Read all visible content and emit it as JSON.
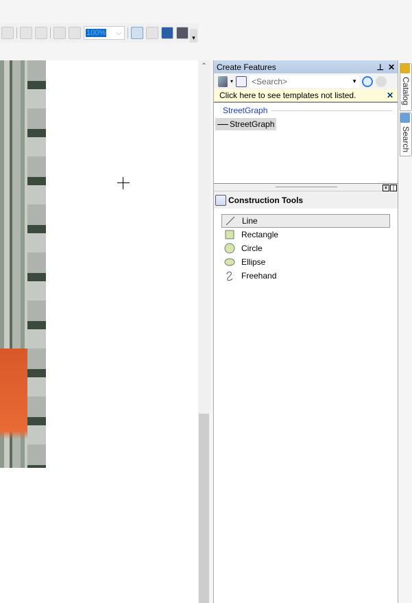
{
  "toolbar": {
    "zoom_value": "100%",
    "icons": [
      "fixed-zoom-icon",
      "zoom-in-fixed-icon",
      "zoom-out-fixed-icon",
      "back-icon",
      "forward-icon",
      "toggle-draft-mode-icon",
      "focus-data-frame-icon",
      "change-layout-icon",
      "data-driven-pages-icon"
    ]
  },
  "create_features": {
    "title": "Create Features",
    "search_placeholder": "<Search>",
    "notice": "Click here to see templates not listed.",
    "group": "StreetGraph",
    "template": "StreetGraph"
  },
  "construction_tools": {
    "title": "Construction Tools",
    "tools": [
      {
        "label": "Line",
        "icon": "line-icon",
        "selected": true
      },
      {
        "label": "Rectangle",
        "icon": "rectangle-icon"
      },
      {
        "label": "Circle",
        "icon": "circle-icon"
      },
      {
        "label": "Ellipse",
        "icon": "ellipse-icon"
      },
      {
        "label": "Freehand",
        "icon": "freehand-icon"
      }
    ]
  },
  "side_tabs": [
    "Catalog",
    "Search"
  ],
  "colors": {
    "accent": "#0a6ccf",
    "title_bar": "#b7cbe4",
    "notice_bg": "#fdfbd9",
    "group_text": "#1a3dc1"
  }
}
